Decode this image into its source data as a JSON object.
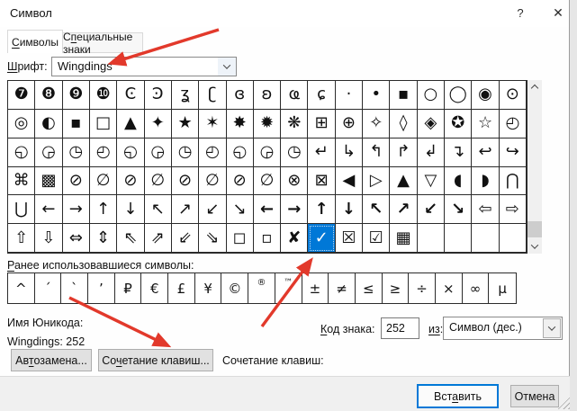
{
  "window": {
    "title": "Символ",
    "help_glyph": "?",
    "close_glyph": "✕"
  },
  "tabs": [
    {
      "pre": "",
      "key": "С",
      "post": "имволы"
    },
    {
      "pre": "С",
      "key": "п",
      "post": "ециальные знаки"
    }
  ],
  "font": {
    "label": {
      "pre": "",
      "key": "Ш",
      "post": "рифт:"
    },
    "value": "Wingdings"
  },
  "symbol_grid": {
    "rows": [
      [
        "❼",
        "❽",
        "❾",
        "❿",
        "Ͼ",
        "Ͽ",
        "ʓ",
        "ʗ",
        "ɞ",
        "ʚ",
        "ҩ",
        "ɕ",
        "·",
        "•",
        "▪",
        "○",
        "◯",
        "◉",
        "⊙"
      ],
      [
        "◎",
        "◐",
        "▪",
        "□",
        "▲",
        "✦",
        "★",
        "✶",
        "✸",
        "✹",
        "❋",
        "⊞",
        "⊕",
        "✧",
        "◊",
        "◈",
        "✪",
        "☆",
        "◴"
      ],
      [
        "◵",
        "◶",
        "◷",
        "◴",
        "◵",
        "◶",
        "◷",
        "◴",
        "◵",
        "◶",
        "◷",
        "↵",
        "↳",
        "↰",
        "↱",
        "↲",
        "↴",
        "↩",
        "↪"
      ],
      [
        "⌘",
        "▩",
        "⊘",
        "∅",
        "⊘",
        "∅",
        "⊘",
        "∅",
        "⊘",
        "∅",
        "⊗",
        "⊠",
        "◀",
        "▷",
        "▲",
        "▽",
        "◖",
        "◗",
        "⋂"
      ],
      [
        "⋃",
        "←",
        "→",
        "↑",
        "↓",
        "↖",
        "↗",
        "↙",
        "↘",
        {
          "g": "←",
          "b": 1
        },
        {
          "g": "→",
          "b": 1
        },
        {
          "g": "↑",
          "b": 1
        },
        {
          "g": "↓",
          "b": 1
        },
        {
          "g": "↖",
          "b": 1
        },
        {
          "g": "↗",
          "b": 1
        },
        {
          "g": "↙",
          "b": 1
        },
        {
          "g": "↘",
          "b": 1
        },
        "⇦",
        "⇨"
      ],
      [
        "⇧",
        "⇩",
        "⇔",
        "⇕",
        "⇖",
        "⇗",
        "⇙",
        "⇘",
        "◻",
        "▫",
        {
          "g": "✘",
          "b": 1
        },
        {
          "g": "✓",
          "b": 1
        },
        "☒",
        "☑",
        "▦",
        "",
        "",
        "",
        ""
      ]
    ],
    "selected": {
      "row": 5,
      "col": 11,
      "glyph": "✓"
    }
  },
  "recent": {
    "label": {
      "pre": "",
      "key": "Р",
      "post": "анее использовавшиеся символы:"
    },
    "symbols": [
      "^",
      "´",
      "`",
      "’",
      "₽",
      "€",
      "£",
      "¥",
      "©",
      {
        "g": "®",
        "sm": 1
      },
      {
        "g": "™",
        "sm": 1
      },
      "±",
      "≠",
      "≤",
      "≥",
      "÷",
      "×",
      "∞",
      "µ"
    ]
  },
  "unicode_name": {
    "label": "Имя Юникода:",
    "value": "Wingdings: 252"
  },
  "char_code": {
    "label": {
      "pre": "",
      "key": "К",
      "post": "од знака:"
    },
    "value": "252"
  },
  "from": {
    "label": {
      "pre": "",
      "key": "из",
      "post": ":"
    },
    "value": "Символ (дес.)"
  },
  "buttons": {
    "autocorrect": {
      "pre": "Ав",
      "key": "т",
      "post": "озамена..."
    },
    "shortcut": {
      "pre": "Со",
      "key": "ч",
      "post": "етание клавиш..."
    },
    "shortcut_static": "Сочетание клавиш:",
    "insert": {
      "pre": "Вст",
      "key": "а",
      "post": "вить"
    },
    "cancel": "Отмена"
  },
  "colors": {
    "selection": "#0078d7",
    "annotation_arrow": "#e2392b"
  }
}
